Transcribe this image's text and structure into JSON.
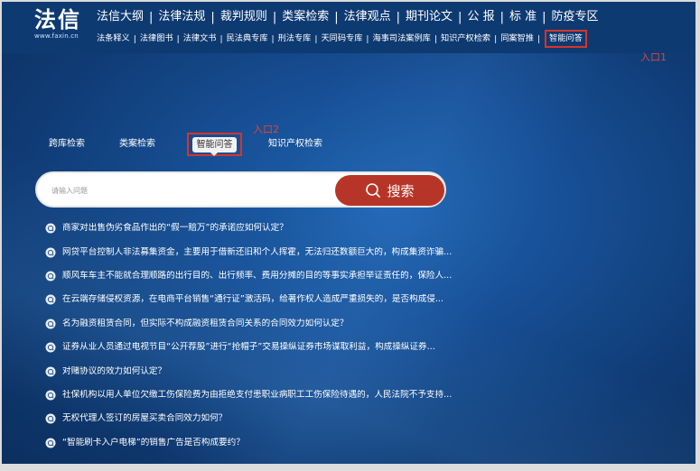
{
  "header": {
    "logo": "法信",
    "logo_sub": "www.faxin.cn",
    "nav_primary": [
      "法信大纲",
      "法律法规",
      "裁判规则",
      "类案检索",
      "法律观点",
      "期刊论文",
      "公 报",
      "标 准",
      "防疫专区"
    ],
    "nav_secondary": [
      "法条释义",
      "法律图书",
      "法律文书",
      "民法典专库",
      "刑法专库",
      "天同码专库",
      "海事司法案例库",
      "知识产权检索",
      "同案智推",
      "智能问答"
    ]
  },
  "annotations": {
    "entry1": "入口1",
    "entry2": "入口2"
  },
  "search_tabs": {
    "tab1": "跨库检索",
    "tab2": "类案检索",
    "tab3_active": "智能问答",
    "tab4": "知识产权检索"
  },
  "search": {
    "placeholder": "请输入问题",
    "button_label": "搜索"
  },
  "questions": [
    "商家对出售伪劣食品作出的“假一赔万”的承诺应如何认定？",
    "网贷平台控制人非法募集资金，主要用于借新还旧和个人挥霍，无法归还数额巨大的，构成集资诈骗...",
    "顺风车车主不能就合理顺路的出行目的、出行频率、费用分摊的目的等事实承担举证责任的，保险人...",
    "在云端存储侵权资源，在电商平台销售“通行证”激活码，给著作权人造成严重损失的，是否构成侵...",
    "名为融资租赁合同，但实际不构成融资租赁合同关系的合同效力如何认定？",
    "证券从业人员通过电视节目“公开荐股”进行“抢帽子”交易操纵证券市场谋取利益，构成操纵证券...",
    "对赌协议的效力如何认定？",
    "社保机构以用人单位欠缴工伤保险费为由拒绝支付患职业病职工工伤保险待遇的，人民法院不予支持...",
    "无权代理人签订的房屋买卖合同效力如何？",
    "“智能刷卡入户电梯”的销售广告是否构成要约？"
  ],
  "colors": {
    "background_blue": "#174f95",
    "accent_red": "#b73528",
    "highlight_red": "#d8342a"
  },
  "icons": {
    "question_bubble": "question-bubble-icon",
    "search": "search-icon"
  }
}
